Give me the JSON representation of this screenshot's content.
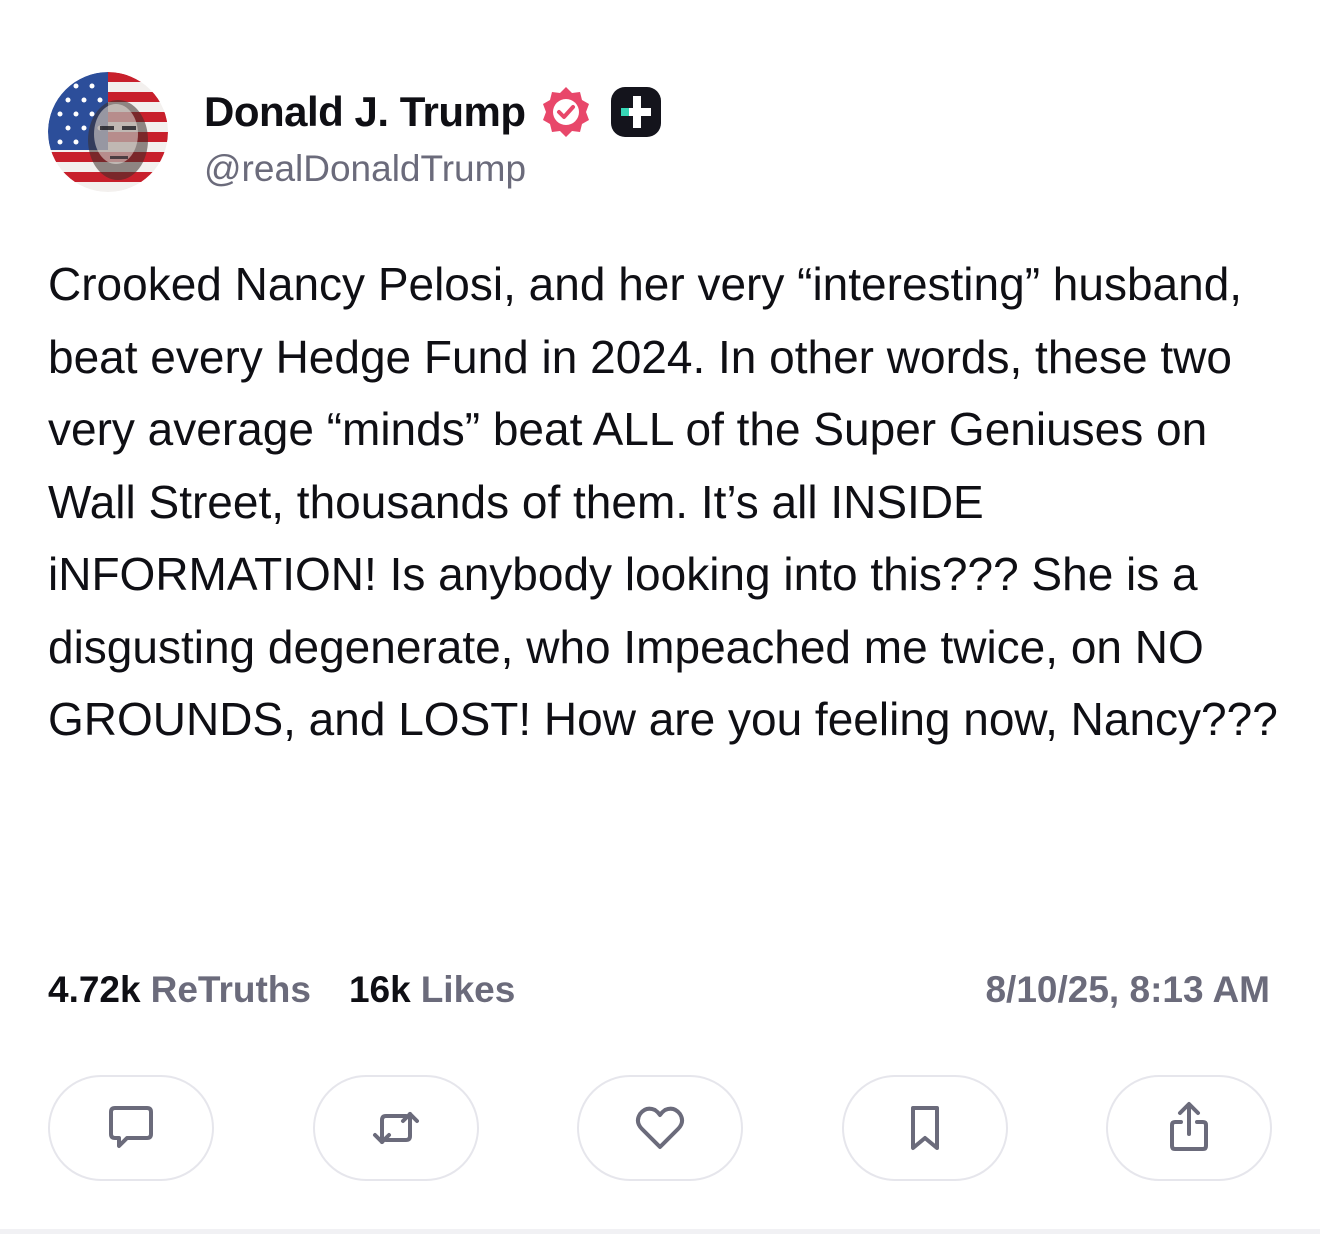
{
  "author": {
    "display_name": "Donald J. Trump",
    "handle": "@realDonaldTrump",
    "avatar_icon": "avatar-flag-portrait",
    "verified_icon": "verified-badge-icon",
    "verified_color": "#e8476a",
    "plus_icon": "plus-badge-icon"
  },
  "post": {
    "text": "Crooked Nancy Pelosi, and her very “interesting” husband, beat every Hedge Fund in 2024. In other words, these two very average “minds” beat ALL of the Super Geniuses on Wall Street, thousands of them. It’s all INSIDE iNFORMATION! Is anybody looking into this??? She is a disgusting degenerate, who Impeached me twice, on NO GROUNDS, and LOST! How are you feeling now, Nancy???"
  },
  "stats": {
    "retruths_count": "4.72k",
    "retruths_label": "ReTruths",
    "likes_count": "16k",
    "likes_label": "Likes",
    "timestamp": "8/10/25, 8:13 AM"
  },
  "actions": [
    {
      "name": "reply",
      "icon": "comment-icon"
    },
    {
      "name": "retruth",
      "icon": "repost-icon"
    },
    {
      "name": "like",
      "icon": "heart-icon"
    },
    {
      "name": "bookmark",
      "icon": "bookmark-icon"
    },
    {
      "name": "share",
      "icon": "share-icon"
    }
  ],
  "colors": {
    "text_primary": "#0f0f14",
    "text_secondary": "#6b6b7b",
    "button_border": "#e6e6ec",
    "icon_stroke": "#6b6b7b"
  }
}
